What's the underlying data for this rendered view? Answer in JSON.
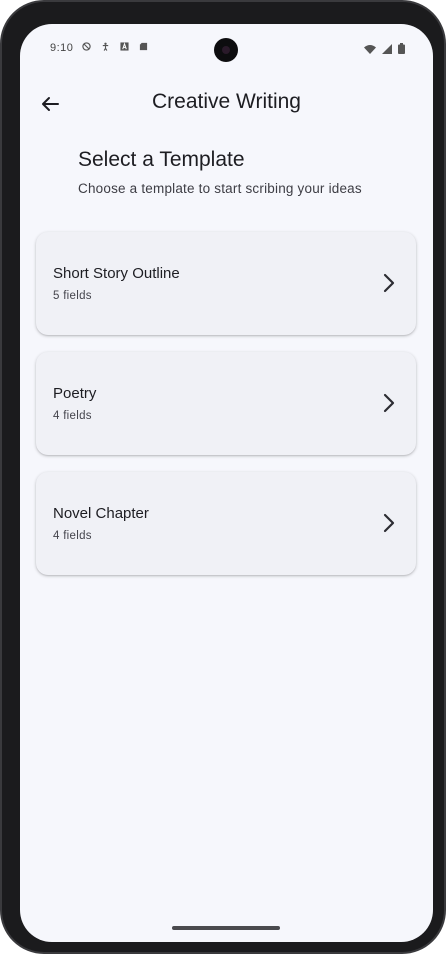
{
  "status_bar": {
    "time": "9:10",
    "left_icons": [
      "no-disturb-icon",
      "accessibility-icon",
      "a-icon",
      "sd-card-icon"
    ],
    "right_icons": [
      "wifi-icon",
      "signal-icon",
      "battery-icon"
    ]
  },
  "app_bar": {
    "back_icon": "arrow-back-icon",
    "title": "Creative Writing"
  },
  "header": {
    "title": "Select a Template",
    "subtitle": "Choose a template to start scribing your ideas"
  },
  "templates": [
    {
      "title": "Short Story Outline",
      "subtitle": "5 fields",
      "icon": "chevron-right-icon"
    },
    {
      "title": "Poetry",
      "subtitle": "4 fields",
      "icon": "chevron-right-icon"
    },
    {
      "title": "Novel Chapter",
      "subtitle": "4 fields",
      "icon": "chevron-right-icon"
    }
  ],
  "colors": {
    "background": "#f6f7fc",
    "card": "#f0f1f6",
    "text_primary": "#1d1d22",
    "text_secondary": "#44444c"
  }
}
